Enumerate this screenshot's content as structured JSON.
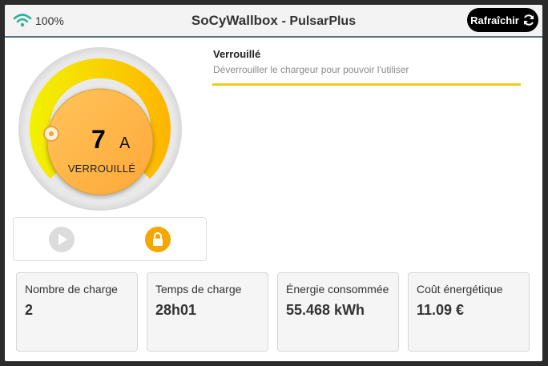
{
  "header": {
    "battery": "100%",
    "title_main": "SoCyWallbox",
    "title_sub": "- PulsarPlus",
    "refresh_label": "Rafraîchir",
    "icons": {
      "wifi": "wifi-icon",
      "refresh": "refresh-icon"
    }
  },
  "gauge": {
    "current_value": "7",
    "unit": "A",
    "state": "VERROUILLÉ",
    "level_fraction": 0.0,
    "colors": {
      "arc_start": "#f2f200",
      "arc_end": "#ffb400",
      "center": "#ffb347"
    }
  },
  "controls": {
    "play_icon": "play-icon",
    "lock_icon": "lock-icon",
    "play_color": "#dcdcdc",
    "lock_color": "#f5a600"
  },
  "status": {
    "title": "Verrouillé",
    "description": "Déverrouiller le chargeur pour pouvoir l'utiliser",
    "accent": "#f2cb1a"
  },
  "stats": [
    {
      "label": "Nombre de charge",
      "value": "2"
    },
    {
      "label": "Temps de charge",
      "value": "28h01"
    },
    {
      "label": "Énergie consommée",
      "value": "55.468 kWh"
    },
    {
      "label": "Coût énergétique",
      "value": "11.09 €"
    }
  ]
}
